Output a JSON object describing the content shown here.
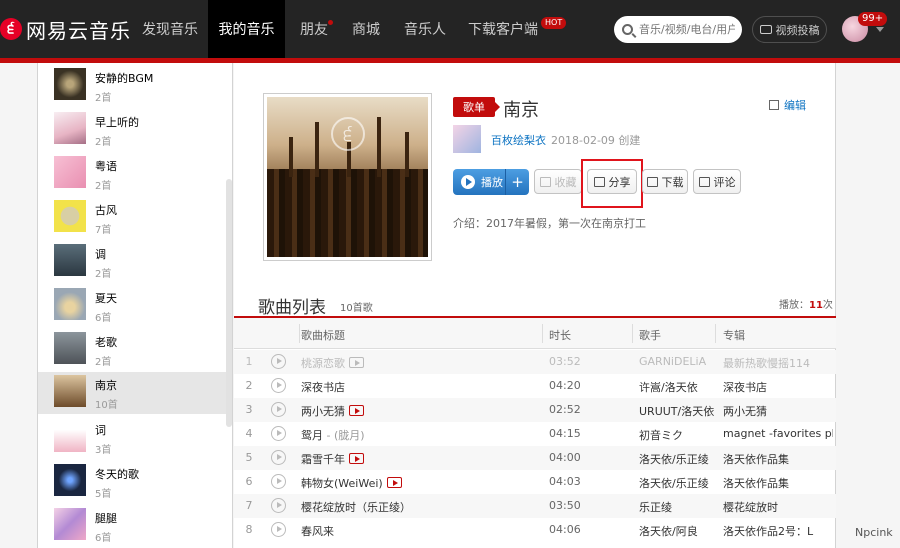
{
  "brand": {
    "logo_symbol": "੬",
    "name": "网易云音乐"
  },
  "nav": [
    {
      "label": "发现音乐"
    },
    {
      "label": "我的音乐",
      "active": true
    },
    {
      "label": "朋友"
    },
    {
      "label": "商城"
    },
    {
      "label": "音乐人"
    },
    {
      "label": "下载客户端",
      "badge": "HOT"
    }
  ],
  "search": {
    "placeholder": "音乐/视频/电台/用户"
  },
  "upload_label": "视频投稿",
  "notify_badge": "99+",
  "sidebar": {
    "items": [
      {
        "name": "安静的BGM",
        "count": "2首"
      },
      {
        "name": "早上听的",
        "count": "2首"
      },
      {
        "name": "粤语",
        "count": "2首"
      },
      {
        "name": "古风",
        "count": "7首"
      },
      {
        "name": "调",
        "count": "2首"
      },
      {
        "name": "夏天",
        "count": "6首"
      },
      {
        "name": "老歌",
        "count": "2首"
      },
      {
        "name": "南京",
        "count": "10首"
      },
      {
        "name": "词",
        "count": "3首"
      },
      {
        "name": "冬天的歌",
        "count": "5首"
      },
      {
        "name": "腿腿",
        "count": "6首"
      }
    ]
  },
  "playlist": {
    "tag": "歌单",
    "title": "南京",
    "edit_label": "编辑",
    "creator": "百枚绘梨衣",
    "created": "2018-02-09 创建",
    "intro": "介绍：2017年暑假，第一次在南京打工",
    "cover_symbol": "੬"
  },
  "actions": {
    "play": "播放",
    "add": "+",
    "collect": "收藏",
    "share": "分享",
    "download": "下载",
    "comment": "评论"
  },
  "songlist": {
    "title": "歌曲列表",
    "count": "10首歌",
    "plays_label": "播放：",
    "plays_value": "11",
    "plays_unit": "次",
    "columns": [
      "歌曲标题",
      "时长",
      "歌手",
      "专辑"
    ],
    "rows": [
      {
        "n": "1",
        "title": "桃源恋歌",
        "sub": "",
        "mv": true,
        "time": "03:52",
        "artist": "GARNiDELiA",
        "album": "最新热歌慢摇114",
        "disabled": true
      },
      {
        "n": "2",
        "title": "深夜书店",
        "sub": "",
        "mv": false,
        "time": "04:20",
        "artist": "许嵩/洛天依",
        "album": "深夜书店"
      },
      {
        "n": "3",
        "title": "两小无猜",
        "sub": "",
        "mv": true,
        "time": "02:52",
        "artist": "URUUT/洛天依",
        "album": "两小无猜"
      },
      {
        "n": "4",
        "title": "鸳月",
        "sub": " - (胧月)",
        "mv": false,
        "time": "04:15",
        "artist": "初音ミク",
        "album": "magnet -favorites plus-"
      },
      {
        "n": "5",
        "title": "霜雪千年",
        "sub": "",
        "mv": true,
        "time": "04:00",
        "artist": "洛天依/乐正绫",
        "album": "洛天依作品集"
      },
      {
        "n": "6",
        "title": "韩物女(WeiWei)",
        "sub": "",
        "mv": true,
        "time": "04:03",
        "artist": "洛天依/乐正绫",
        "album": "洛天依作品集"
      },
      {
        "n": "7",
        "title": "樱花绽放时（乐正绫）",
        "sub": "",
        "mv": false,
        "time": "03:50",
        "artist": "乐正绫",
        "album": "樱花绽放时"
      },
      {
        "n": "8",
        "title": "春风来",
        "sub": "",
        "mv": false,
        "time": "04:06",
        "artist": "洛天依/阿良",
        "album": "洛天依作品2号：L"
      }
    ]
  },
  "watermark": "Npcink",
  "colors": {
    "brand_red": "#c20c0c",
    "link_blue": "#0c73c2",
    "topbar": "#242424",
    "play_blue": "#2473be"
  }
}
